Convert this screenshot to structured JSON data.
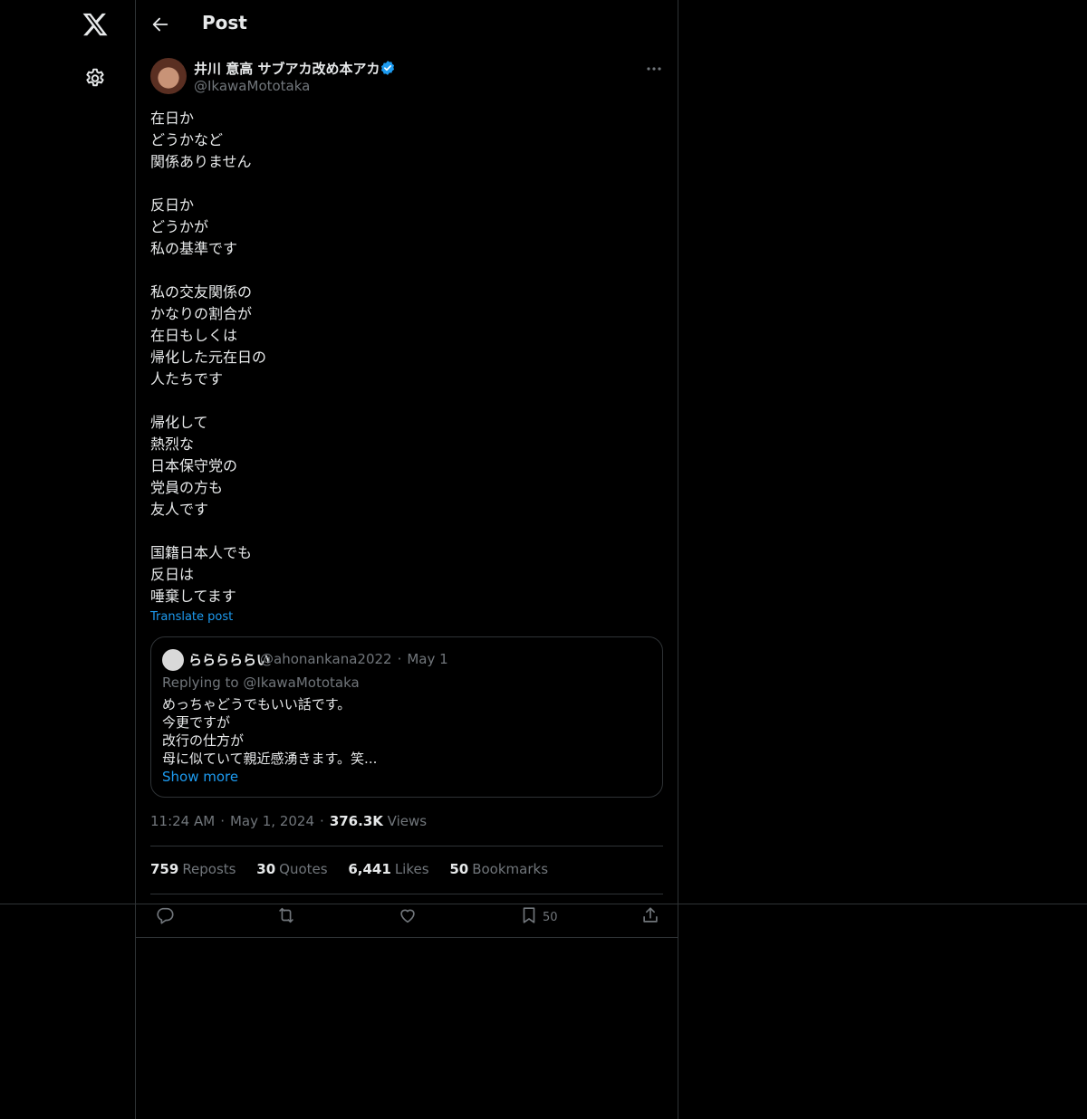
{
  "header": {
    "title": "Post"
  },
  "author": {
    "display_name": "井川 意高 サブアカ改め本アカ",
    "handle": "@IkawaMototaka",
    "verified": true
  },
  "post": {
    "paragraphs": [
      [
        "在日か",
        "どうかなど",
        "関係ありません"
      ],
      [
        "反日か",
        "どうかが",
        "私の基準です"
      ],
      [
        "私の交友関係の",
        "かなりの割合が",
        "在日もしくは",
        "帰化した元在日の",
        "人たちです"
      ],
      [
        "帰化して",
        "熱烈な",
        "日本保守党の",
        "党員の方も",
        "友人です"
      ],
      [
        "国籍日本人でも",
        "反日は",
        "唾棄してます"
      ]
    ],
    "translate_label": "Translate post"
  },
  "quote": {
    "name": "らららららい",
    "handle": "@ahonankana2022",
    "date": "May 1",
    "replying_to": "Replying to @IkawaMototaka",
    "lines": [
      "めっちゃどうでもいい話です。",
      "今更ですが",
      "改行の仕方が",
      "母に似ていて親近感湧きます。笑..."
    ],
    "show_more": "Show more"
  },
  "meta": {
    "time": "11:24 AM",
    "date": "May 1, 2024",
    "views_count": "376.3K",
    "views_label": "Views"
  },
  "stats": {
    "reposts": {
      "count": "759",
      "label": "Reposts"
    },
    "quotes": {
      "count": "30",
      "label": "Quotes"
    },
    "likes": {
      "count": "6,441",
      "label": "Likes"
    },
    "bookmarks": {
      "count": "50",
      "label": "Bookmarks"
    }
  },
  "actions": {
    "bookmark_count": "50"
  },
  "icons": [
    "x-logo-icon",
    "gear-icon",
    "back-arrow-icon",
    "verified-badge-icon",
    "more-icon",
    "reply-icon",
    "repost-icon",
    "like-icon",
    "bookmark-icon",
    "share-icon"
  ],
  "colors": {
    "background": "#000000",
    "text": "#e7e9ea",
    "muted": "#71767b",
    "accent": "#1d9bf0",
    "border": "#2f3336"
  }
}
